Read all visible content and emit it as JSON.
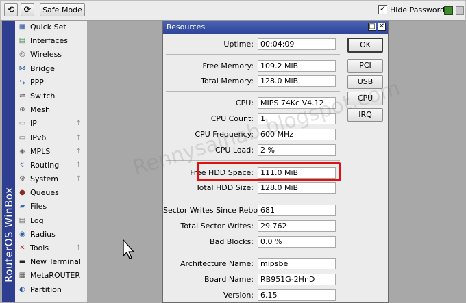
{
  "toolbar": {
    "undo_icon": "undo-icon",
    "redo_icon": "redo-icon",
    "safe_mode_label": "Safe Mode",
    "hide_passwords_label": "Hide Passwords",
    "hide_passwords_checked": true
  },
  "brand": {
    "text": "RouterOS WinBox"
  },
  "menu": {
    "items": [
      {
        "label": "Quick Set",
        "icon": "quick-set-icon",
        "submenu": false
      },
      {
        "label": "Interfaces",
        "icon": "interfaces-icon",
        "submenu": false
      },
      {
        "label": "Wireless",
        "icon": "wireless-icon",
        "submenu": false
      },
      {
        "label": "Bridge",
        "icon": "bridge-icon",
        "submenu": false
      },
      {
        "label": "PPP",
        "icon": "ppp-icon",
        "submenu": false
      },
      {
        "label": "Switch",
        "icon": "switch-icon",
        "submenu": false
      },
      {
        "label": "Mesh",
        "icon": "mesh-icon",
        "submenu": false
      },
      {
        "label": "IP",
        "icon": "ip-icon",
        "submenu": true
      },
      {
        "label": "IPv6",
        "icon": "ipv6-icon",
        "submenu": true
      },
      {
        "label": "MPLS",
        "icon": "mpls-icon",
        "submenu": true
      },
      {
        "label": "Routing",
        "icon": "routing-icon",
        "submenu": true
      },
      {
        "label": "System",
        "icon": "system-icon",
        "submenu": true
      },
      {
        "label": "Queues",
        "icon": "queues-icon",
        "submenu": false
      },
      {
        "label": "Files",
        "icon": "files-icon",
        "submenu": false
      },
      {
        "label": "Log",
        "icon": "log-icon",
        "submenu": false
      },
      {
        "label": "Radius",
        "icon": "radius-icon",
        "submenu": false
      },
      {
        "label": "Tools",
        "icon": "tools-icon",
        "submenu": true
      },
      {
        "label": "New Terminal",
        "icon": "terminal-icon",
        "submenu": false
      },
      {
        "label": "MetaROUTER",
        "icon": "metarouter-icon",
        "submenu": false
      },
      {
        "label": "Partition",
        "icon": "partition-icon",
        "submenu": false
      }
    ],
    "submenu_arrow": "↑"
  },
  "window": {
    "title": "Resources",
    "fields": {
      "uptime": {
        "label": "Uptime:",
        "value": "00:04:09"
      },
      "free_memory": {
        "label": "Free Memory:",
        "value": "109.2 MiB"
      },
      "total_memory": {
        "label": "Total Memory:",
        "value": "128.0 MiB"
      },
      "cpu": {
        "label": "CPU:",
        "value": "MIPS 74Kc V4.12"
      },
      "cpu_count": {
        "label": "CPU Count:",
        "value": "1"
      },
      "cpu_frequency": {
        "label": "CPU Frequency:",
        "value": "600 MHz"
      },
      "cpu_load": {
        "label": "CPU Load:",
        "value": "2 %"
      },
      "free_hdd": {
        "label": "Free HDD Space:",
        "value": "111.0 MiB"
      },
      "total_hdd": {
        "label": "Total HDD Size:",
        "value": "128.0 MiB"
      },
      "sector_writes_reboot": {
        "label": "Sector Writes Since Reboot:",
        "value": "681"
      },
      "total_sector_writes": {
        "label": "Total Sector Writes:",
        "value": "29 762"
      },
      "bad_blocks": {
        "label": "Bad Blocks:",
        "value": "0.0 %"
      },
      "architecture": {
        "label": "Architecture Name:",
        "value": "mipsbe"
      },
      "board_name": {
        "label": "Board Name:",
        "value": "RB951G-2HnD"
      },
      "version": {
        "label": "Version:",
        "value": "6.15"
      }
    },
    "buttons": {
      "ok": "OK",
      "pci": "PCI",
      "usb": "USB",
      "cpu": "CPU",
      "irq": "IRQ"
    }
  },
  "watermark": "Rennysalhab.blogspot.com",
  "colors": {
    "brand_blue": "#2e3f91",
    "title_blue": "#3b54a8",
    "highlight_red": "#dd1111",
    "lock_green": "#3f8b2d"
  }
}
